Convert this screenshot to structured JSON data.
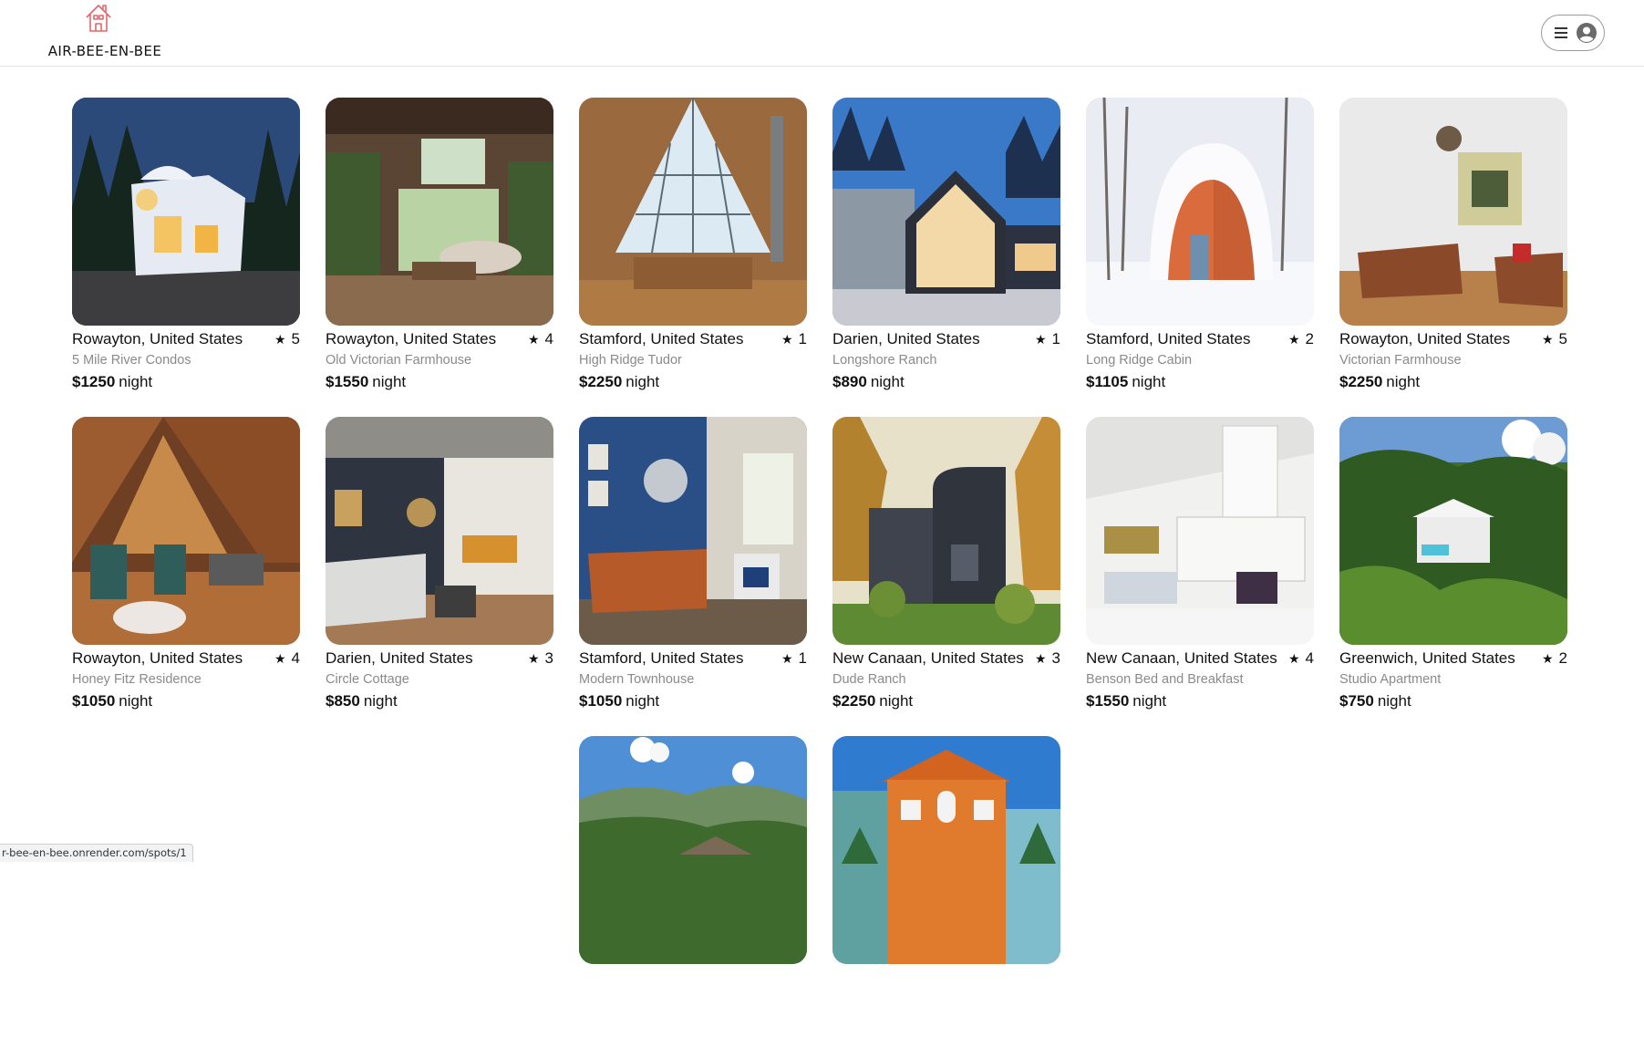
{
  "app": {
    "logo_text": "AIR-BEE-EN-BEE",
    "logo_icon": "house-icon",
    "brand_color": "#e0666a"
  },
  "header": {
    "menu_icon": "hamburger-menu-icon",
    "user_icon": "user-circle-icon"
  },
  "spots": [
    {
      "location": "Rowayton, United States",
      "rating": "5",
      "name": "5 Mile River Condos",
      "price": "$1250",
      "unit": "night"
    },
    {
      "location": "Rowayton, United States",
      "rating": "4",
      "name": "Old Victorian Farmhouse",
      "price": "$1550",
      "unit": "night"
    },
    {
      "location": "Stamford, United States",
      "rating": "1",
      "name": "High Ridge Tudor",
      "price": "$2250",
      "unit": "night"
    },
    {
      "location": "Darien, United States",
      "rating": "1",
      "name": "Longshore Ranch",
      "price": "$890",
      "unit": "night"
    },
    {
      "location": "Stamford, United States",
      "rating": "2",
      "name": "Long Ridge Cabin",
      "price": "$1105",
      "unit": "night"
    },
    {
      "location": "Rowayton, United States",
      "rating": "5",
      "name": "Victorian Farmhouse",
      "price": "$2250",
      "unit": "night"
    },
    {
      "location": "Rowayton, United States",
      "rating": "4",
      "name": "Honey Fitz Residence",
      "price": "$1050",
      "unit": "night"
    },
    {
      "location": "Darien, United States",
      "rating": "3",
      "name": "Circle Cottage",
      "price": "$850",
      "unit": "night"
    },
    {
      "location": "Stamford, United States",
      "rating": "1",
      "name": "Modern Townhouse",
      "price": "$1050",
      "unit": "night"
    },
    {
      "location": "New Canaan, United States",
      "rating": "3",
      "name": "Dude Ranch",
      "price": "$2250",
      "unit": "night"
    },
    {
      "location": "New Canaan, United States",
      "rating": "4",
      "name": "Benson Bed and Breakfast",
      "price": "$1550",
      "unit": "night"
    },
    {
      "location": "Greenwich, United States",
      "rating": "2",
      "name": "Studio Apartment",
      "price": "$750",
      "unit": "night"
    },
    {
      "location": "",
      "rating": "",
      "name": "",
      "price": "",
      "unit": ""
    },
    {
      "location": "",
      "rating": "",
      "name": "",
      "price": "",
      "unit": ""
    }
  ],
  "status_bar": {
    "url": "r-bee-en-bee.onrender.com/spots/1"
  }
}
